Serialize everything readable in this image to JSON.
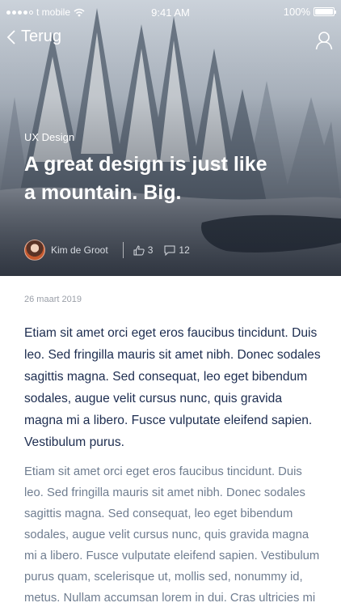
{
  "status_bar": {
    "carrier": "t mobile",
    "time": "9:41 AM",
    "battery": "100%",
    "signal_bars_filled": 4,
    "signal_bars_total": 5,
    "battery_level": 1.0
  },
  "nav": {
    "back_label": "Terug",
    "back_icon": "chevron-left-icon",
    "profile_icon": "user-icon"
  },
  "hero": {
    "category": "UX Design",
    "title": "A great design is just like a mountain. Big."
  },
  "meta": {
    "author": "Kim de Groot",
    "likes": "3",
    "comments": "12",
    "like_icon": "thumbs-up-icon",
    "comment_icon": "comment-icon"
  },
  "article": {
    "date": "26 maart 2019",
    "lead": "Etiam sit amet orci eget eros faucibus tincidunt. Duis leo. Sed fringilla mauris sit amet nibh. Donec sodales sagittis magna. Sed consequat, leo eget bibendum sodales, augue velit cursus nunc, quis gravida magna mi a libero. Fusce vulputate eleifend sapien. Vestibulum purus.",
    "body": "Etiam sit amet orci eget eros faucibus tincidunt. Duis leo. Sed fringilla mauris sit amet nibh. Donec sodales sagittis magna. Sed consequat, leo eget bibendum sodales, augue velit cursus nunc, quis gravida magna mi a libero. Fusce vulputate eleifend sapien. Vestibulum purus quam, scelerisque ut, mollis sed, nonummy id, metus. Nullam accumsan lorem in dui. Cras ultricies mi eu turpis hendrerit fringilla."
  },
  "colors": {
    "title_text": "#ffffff",
    "lead_text": "#1c2c4f",
    "body_text": "#6f7d90",
    "date_text": "#9a9fa8"
  }
}
